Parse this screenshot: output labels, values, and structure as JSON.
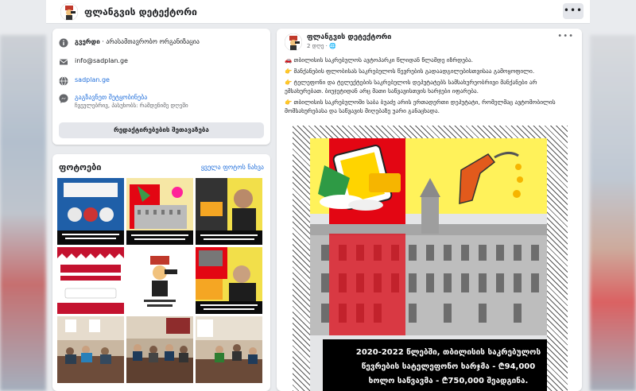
{
  "page": {
    "name": "ფლანგვის დეტექტორი"
  },
  "about": {
    "category_label": "გვერდი",
    "category_value": "არასამთავრობო ორგანიზაცია",
    "email": "info@sadplan.ge",
    "website": "sadplan.ge",
    "messenger_label": "გაგზავნეთ შეტყობინება",
    "messenger_sub": "ჩვეულებრივ, პასუხობს: რამდენიმე დღეში",
    "edit_button": "რედაქტირებების შეთავაზება"
  },
  "photos": {
    "title": "ფოტოები",
    "see_all": "ყველა ფოტოს ნახვა"
  },
  "post": {
    "author": "ფლანგვის დეტექტორი",
    "time": "2 დღე · ",
    "paragraphs": [
      "🚗 თბილისის საკრებულოს ავტოპარკი წლიდან წლამდე იზრდება.",
      "👉 მანქანების ფლობისას საკრებულოს წევრების გადაადგილებისთვისაა გამოყოფილი.",
      "👉 ტელეფონი და ტელექტების საკრებულოს დეპუტატებს სამსახურეობრივი მანქანები არ ემსახურებათ. ბიუჯეტიდან არც მათი საწვავისთვის ხარჯები იფარება.",
      "👉 თბილისის საკრებულოში საბა ბუაძე არის ერთადერთი დეპუტატი, რომელმაც ავტომობილის მომსახურებასა და საწვავის მიღებაზე უარი განაცხადა."
    ],
    "image_caption": [
      "2020-2022 წლებში, თბილისის საკრებულოს",
      "წევრების სატელეფონო ხარჯმა - ₾94,000",
      "ხოლო საწვავმა - ₾750,000 შეადგინა."
    ]
  },
  "colors": {
    "brand_red": "#e30613",
    "link_blue": "#216fdb",
    "button_gray": "#e4e6eb"
  }
}
